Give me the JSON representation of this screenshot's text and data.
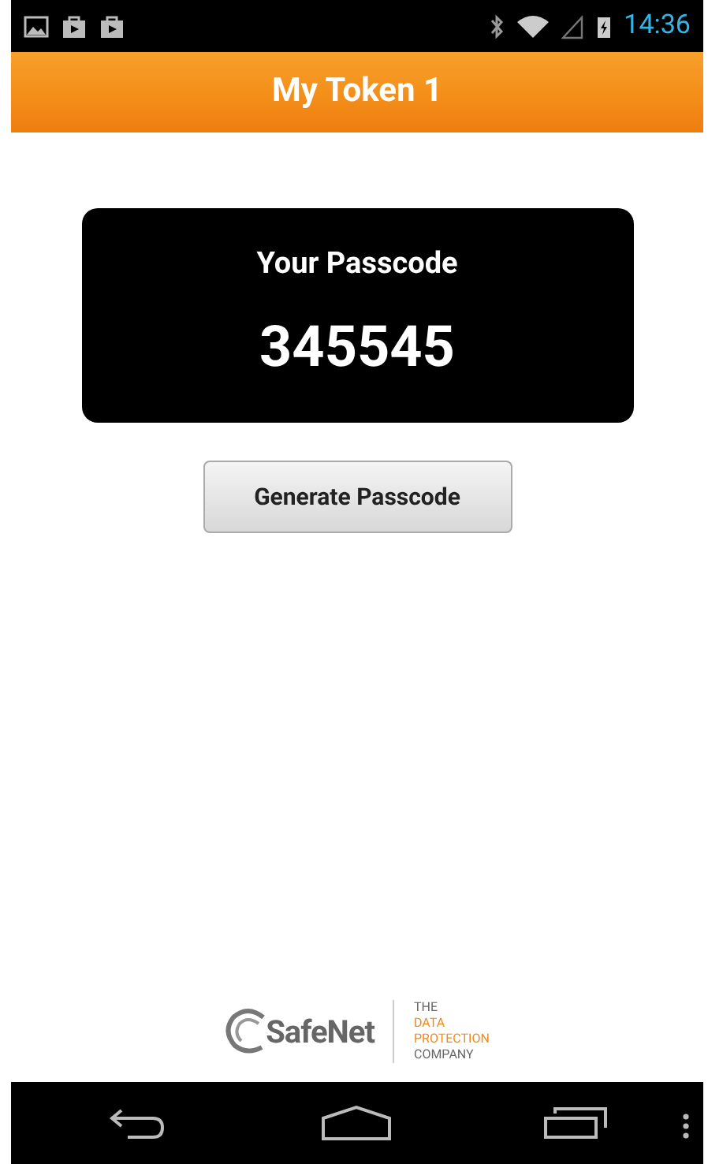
{
  "status_bar": {
    "time": "14:36"
  },
  "action_bar": {
    "title": "My Token 1"
  },
  "passcode_card": {
    "label": "Your Passcode",
    "value": "345545"
  },
  "generate_button": {
    "label": "Generate Passcode"
  },
  "logo": {
    "brand": "SafeNet",
    "tagline": [
      "THE",
      "DATA",
      "PROTECTION",
      "COMPANY"
    ]
  }
}
